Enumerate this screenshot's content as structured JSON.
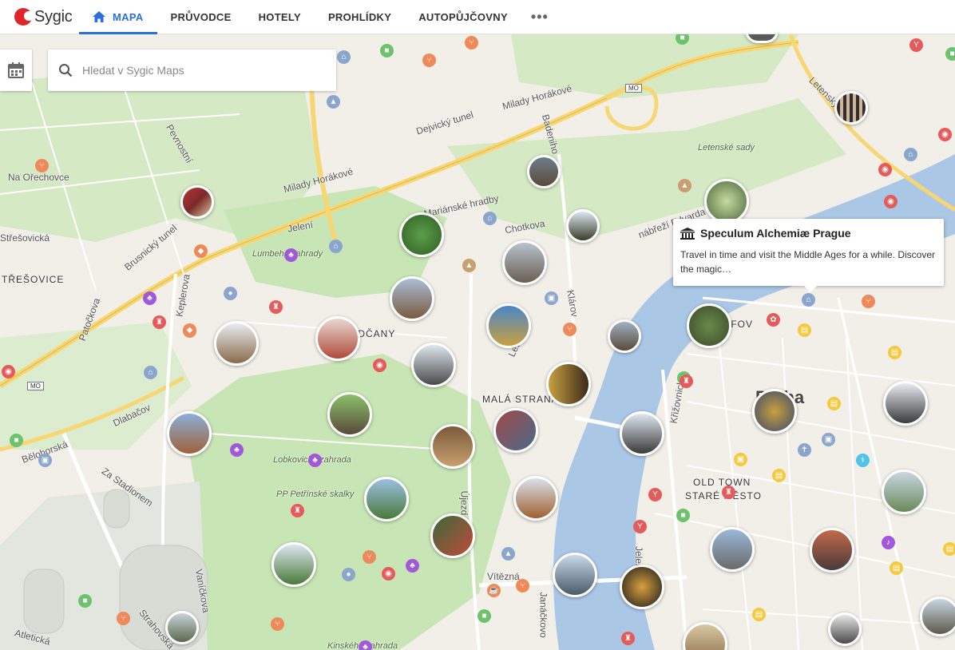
{
  "app": {
    "logo_text": "Sygic"
  },
  "nav": {
    "items": [
      {
        "label": "MAPA",
        "active": true
      },
      {
        "label": "PRŮVODCE"
      },
      {
        "label": "HOTELY"
      },
      {
        "label": "PROHLÍDKY"
      },
      {
        "label": "AUTOPŮJČOVNY"
      }
    ],
    "more": "•••"
  },
  "search": {
    "placeholder": "Hledat v Sygic Maps"
  },
  "popup": {
    "title": "Speculum Alchemiæ Prague",
    "description": "Travel in time and visit the Middle Ages for a while. Discover the magic…"
  },
  "map_labels": {
    "streets": [
      "Milady Horákové",
      "Dejvický tunel",
      "Badeniho",
      "Pevnostní",
      "Na Ořechovce",
      "Jelení",
      "Mariánské hradby",
      "Chotkova",
      "nábřeží Edvarda Beneše",
      "Letenský tunel",
      "Brusnický tunel",
      "Patočkova",
      "Keplerova",
      "Dlabačov",
      "Bělohorská",
      "Za Stadionem",
      "Vaníčkova",
      "Strahovská",
      "Atletická",
      "Klárov",
      "Letenská",
      "Křižovnická",
      "Újezd",
      "Vítězná",
      "Janáčkovo",
      "Jelení",
      "Střešovická",
      "Kinského zahrada",
      "Letenské sady"
    ],
    "districts": [
      "TŘEŠOVICE",
      "HRADČANY",
      "MALÁ STRANA",
      "OLD TOWN",
      "STARÉ MĚSTO",
      "JOSEFOV"
    ],
    "city": "Praha",
    "parks": [
      "Lumbeho zahrady",
      "Lobkovická zahrada",
      "PP Petřínské skalky"
    ],
    "road_badges": [
      "MO",
      "MO"
    ]
  },
  "colors": {
    "nav_active": "#2a6fdb",
    "park": "#c8e6b5",
    "river": "#aac7e6",
    "major_road": "#f7d774",
    "pin_food": "#ee8a5a",
    "pin_sight": "#8ba6cc",
    "pin_shop": "#f5c93e",
    "pin_fun": "#a259d9",
    "pin_green": "#6cc36c",
    "pin_red": "#e55b5b"
  }
}
